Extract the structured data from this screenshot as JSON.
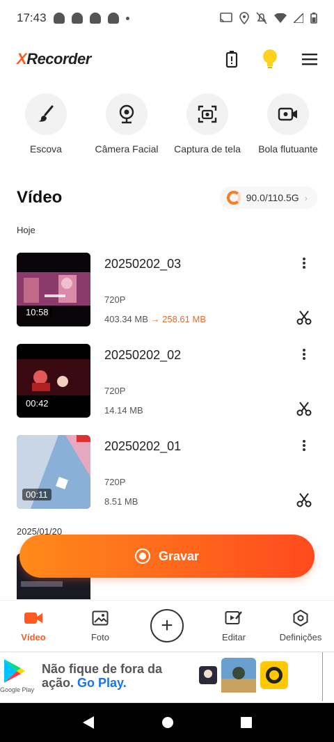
{
  "status_bar": {
    "time": "17:43"
  },
  "app": {
    "logo_x": "X",
    "logo_rest": "Recorder"
  },
  "tools": [
    {
      "label": "Escova"
    },
    {
      "label": "Câmera Facial"
    },
    {
      "label": "Captura de tela"
    },
    {
      "label": "Bola flutuante"
    }
  ],
  "section": {
    "title": "Vídeo",
    "storage": "90.0/110.5G"
  },
  "groups": [
    {
      "date": "Hoje"
    },
    {
      "date": "2025/01/20"
    }
  ],
  "videos": [
    {
      "title": "20250202_03",
      "duration": "10:58",
      "resolution": "720P",
      "size": "403.34 MB",
      "arrow": "→",
      "new_size": "258.61 MB"
    },
    {
      "title": "20250202_02",
      "duration": "00:42",
      "resolution": "720P",
      "size": "14.14 MB"
    },
    {
      "title": "20250202_01",
      "duration": "00:11",
      "resolution": "720P",
      "size": "8.51 MB"
    }
  ],
  "record_button": {
    "label": "Gravar"
  },
  "bottom_nav": [
    {
      "label": "Vídeo"
    },
    {
      "label": "Foto"
    },
    {
      "label": ""
    },
    {
      "label": "Editar"
    },
    {
      "label": "Definições"
    }
  ],
  "ad": {
    "line1": "Não fique de fora da",
    "line2_prefix": "ação.",
    "line2_highlight": "Go Play.",
    "store": "Google Play"
  },
  "colors": {
    "accent": "#ff5a1f",
    "link": "#1a73e8"
  }
}
